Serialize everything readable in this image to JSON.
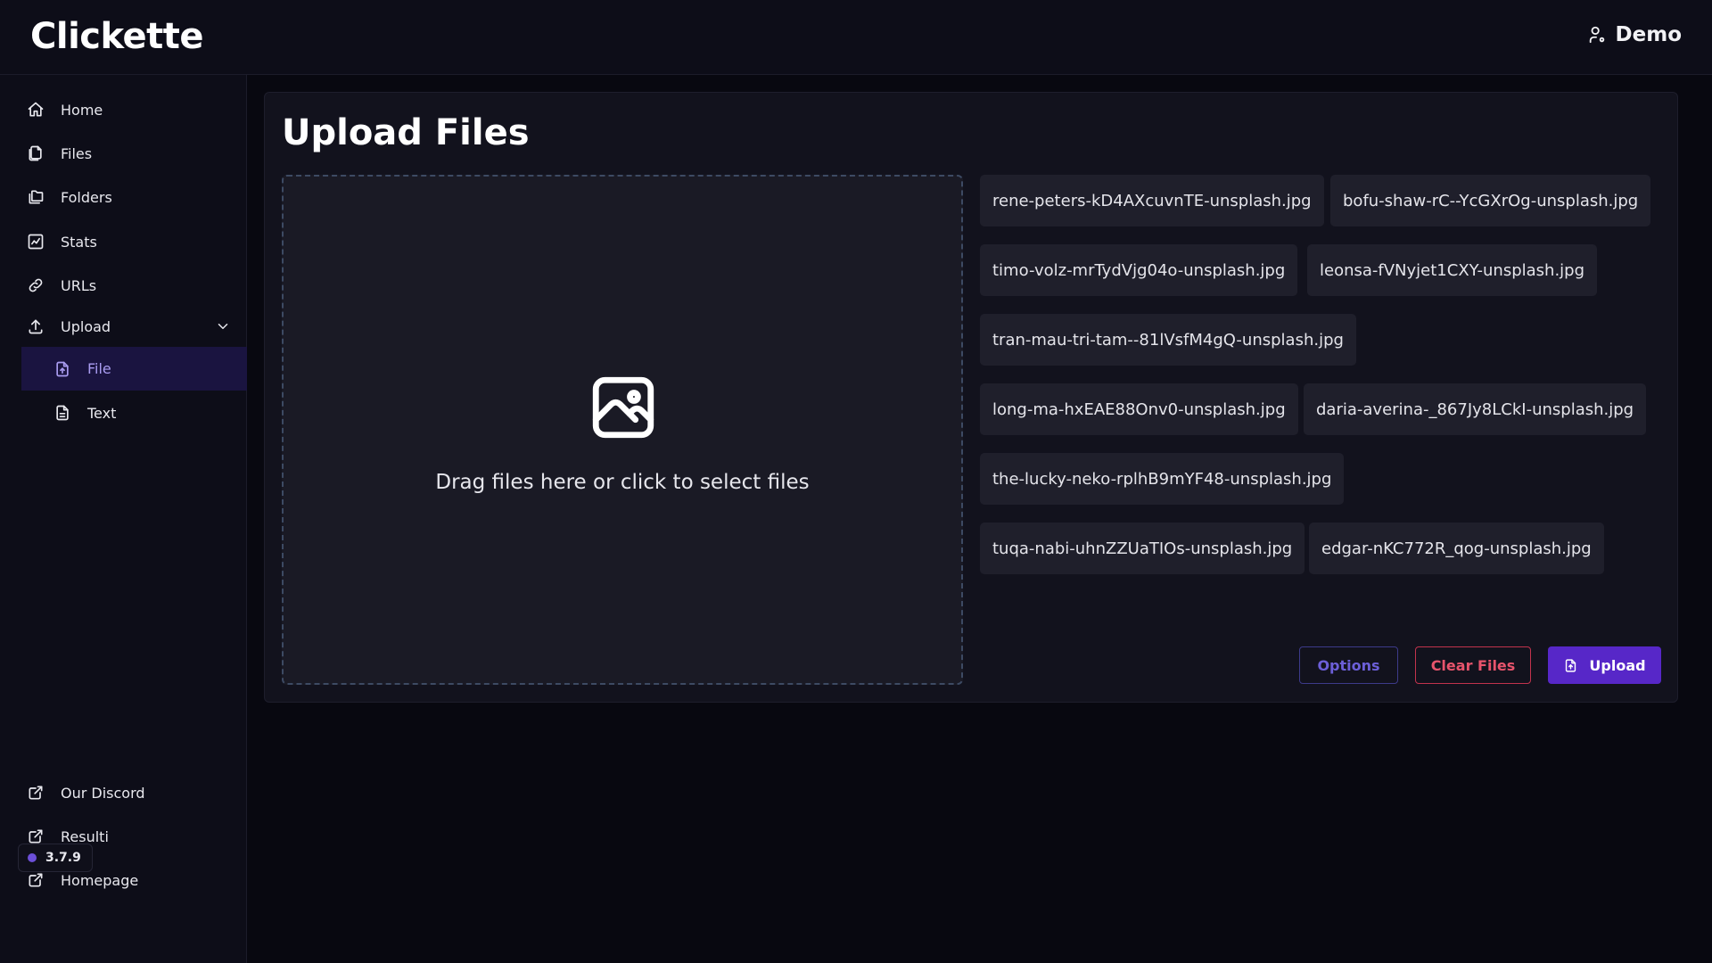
{
  "app": {
    "name": "Clickette"
  },
  "user": {
    "name": "Demo"
  },
  "sidebar": {
    "items": [
      {
        "label": "Home",
        "icon": "home-icon"
      },
      {
        "label": "Files",
        "icon": "files-icon"
      },
      {
        "label": "Folders",
        "icon": "folders-icon"
      },
      {
        "label": "Stats",
        "icon": "stats-icon"
      },
      {
        "label": "URLs",
        "icon": "link-icon"
      },
      {
        "label": "Upload",
        "icon": "upload-icon",
        "expanded": true
      }
    ],
    "upload_sub": [
      {
        "label": "File",
        "icon": "file-upload-icon",
        "active": true
      },
      {
        "label": "Text",
        "icon": "text-file-icon"
      }
    ],
    "external": [
      {
        "label": "Our Discord",
        "icon": "external-link-icon"
      },
      {
        "label": "Resulti",
        "icon": "external-link-icon"
      },
      {
        "label": "Homepage",
        "icon": "external-link-icon"
      }
    ],
    "version": "3.7.9"
  },
  "main": {
    "title": "Upload Files",
    "dropzone_text": "Drag files here or click to select files",
    "files": [
      "rene-peters-kD4AXcuvnTE-unsplash.jpg",
      "bofu-shaw-rC--YcGXrOg-unsplash.jpg",
      "timo-volz-mrTydVjg04o-unsplash.jpg",
      "leonsa-fVNyjet1CXY-unsplash.jpg",
      "tran-mau-tri-tam--81lVsfM4gQ-unsplash.jpg",
      "long-ma-hxEAE88Onv0-unsplash.jpg",
      "daria-averina-_867Jy8LCkI-unsplash.jpg",
      "the-lucky-neko-rplhB9mYF48-unsplash.jpg",
      "tuqa-nabi-uhnZZUaTIOs-unsplash.jpg",
      "edgar-nKC772R_qog-unsplash.jpg"
    ],
    "buttons": {
      "options": "Options",
      "clear": "Clear Files",
      "upload": "Upload"
    }
  },
  "colors": {
    "accent": "#5727c8",
    "active_bg": "#1a1440",
    "danger": "#e8546c",
    "background": "#080810"
  }
}
